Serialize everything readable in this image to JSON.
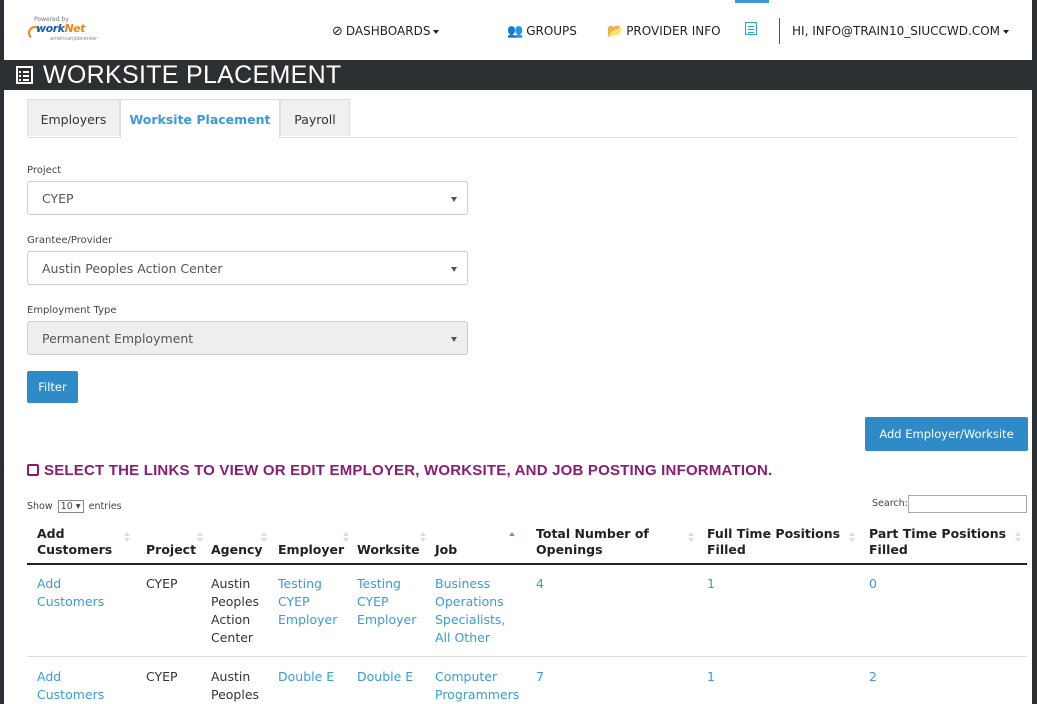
{
  "brand": {
    "tagline": "Powered by",
    "name_a": "work",
    "name_b": "Net",
    "sub": "americanjobcenter"
  },
  "nav": {
    "dashboards": "DASHBOARDS",
    "groups": "GROUPS",
    "provider_info": "PROVIDER INFO",
    "user": "HI, INFO@TRAIN10_SIUCCWD.COM"
  },
  "page_title": "WORKSITE PLACEMENT",
  "tabs": [
    {
      "label": "Employers"
    },
    {
      "label": "Worksite Placement",
      "active": true
    },
    {
      "label": "Payroll"
    }
  ],
  "form": {
    "project": {
      "label": "Project",
      "value": "CYEP"
    },
    "grantee": {
      "label": "Grantee/Provider",
      "value": "Austin Peoples Action Center"
    },
    "employment_type": {
      "label": "Employment Type",
      "value": "Permanent Employment",
      "disabled": true
    },
    "filter_label": "Filter"
  },
  "add_button": "Add Employer/Worksite",
  "instructions": "SELECT THE LINKS TO VIEW OR EDIT EMPLOYER, WORKSITE, AND JOB POSTING INFORMATION.",
  "table_controls": {
    "show_prefix": "Show",
    "entries_value": "10",
    "show_suffix": "entries",
    "search_label": "Search:"
  },
  "table": {
    "columns": [
      "Add\nCustomers",
      "Project",
      "Agency",
      "Employer",
      "Worksite",
      "Job",
      "Total Number of\nOpenings",
      "Full Time Positions\nFilled",
      "Part Time Positions\nFilled"
    ],
    "rows": [
      {
        "add": "Add\nCustomers",
        "project": "CYEP",
        "agency": "Austin\nPeoples\nAction\nCenter",
        "employer": "Testing\nCYEP\nEmployer",
        "worksite": "Testing\nCYEP\nEmployer",
        "job": "Business\nOperations\nSpecialists,\nAll Other",
        "openings": "4",
        "full_time": "1",
        "part_time": "0"
      },
      {
        "add": "Add\nCustomers",
        "project": "CYEP",
        "agency": "Austin\nPeoples",
        "employer": "Double E",
        "worksite": "Double E",
        "job": "Computer\nProgrammers",
        "openings": "7",
        "full_time": "1",
        "part_time": "2"
      }
    ]
  }
}
